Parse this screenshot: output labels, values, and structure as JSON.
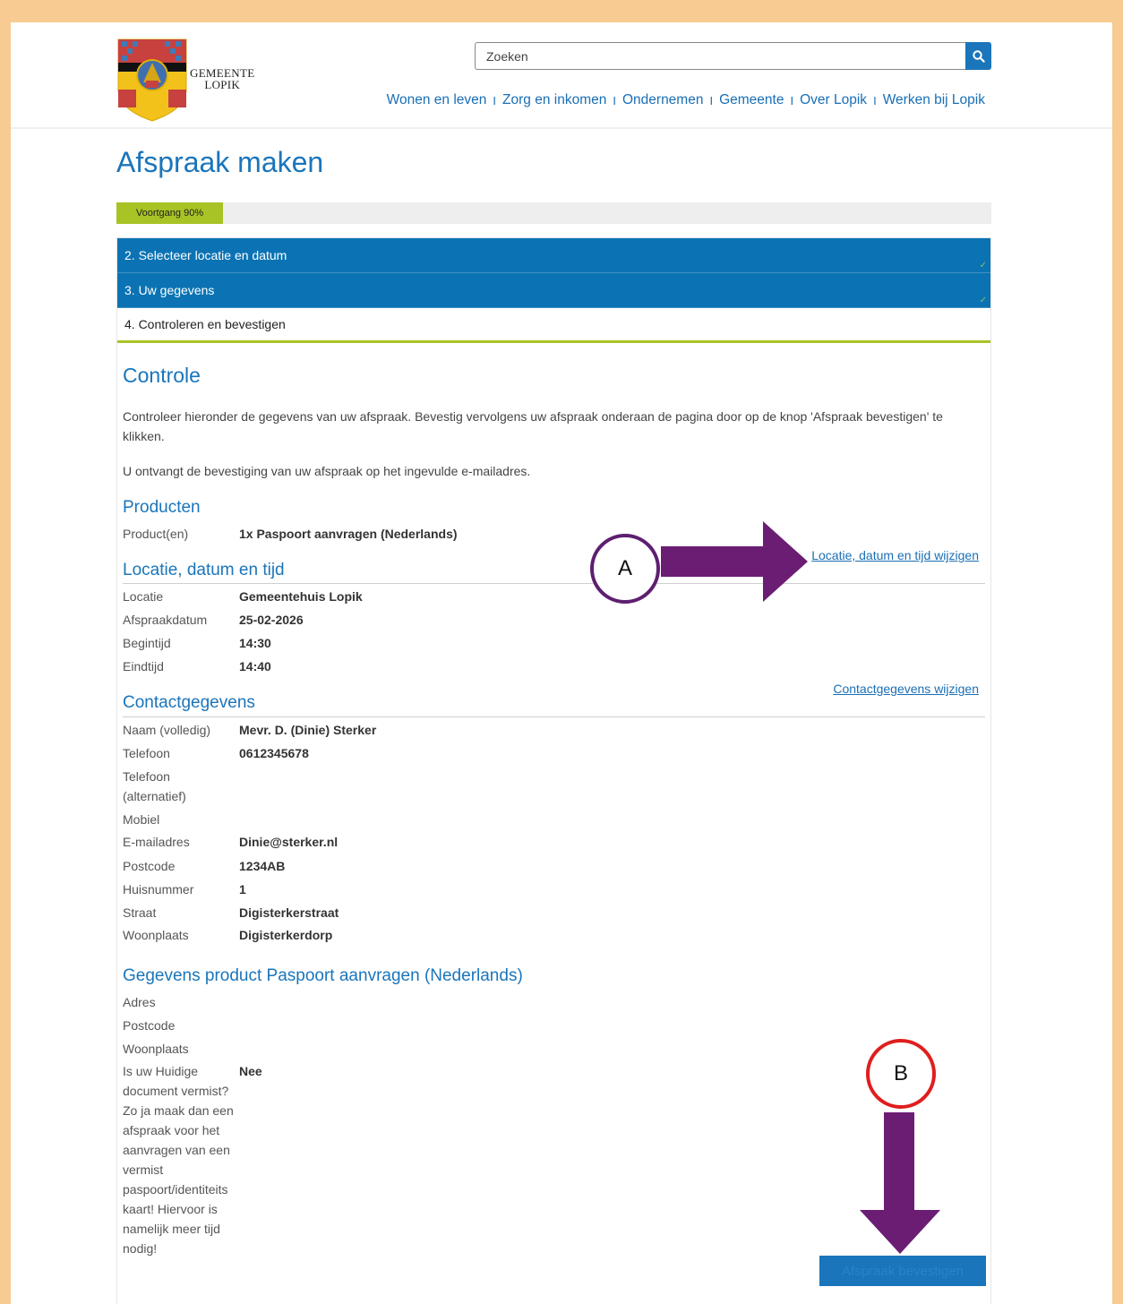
{
  "header": {
    "logo_text_line1": "GEMEENTE",
    "logo_text_line2": "LOPIK",
    "search_placeholder": "Zoeken",
    "nav": [
      "Wonen en leven",
      "Zorg en inkomen",
      "Ondernemen",
      "Gemeente",
      "Over Lopik",
      "Werken bij Lopik"
    ],
    "nav_separator": "I"
  },
  "page_title": "Afspraak maken",
  "progress": {
    "label": "Voortgang 90%",
    "value": 0.9
  },
  "steps": [
    {
      "label": "2. Selecteer locatie en datum",
      "state": "done"
    },
    {
      "label": "3. Uw gegevens",
      "state": "done"
    },
    {
      "label": "4. Controleren en bevestigen",
      "state": "current"
    }
  ],
  "controle": {
    "title": "Controle",
    "intro": "Controleer hieronder de gegevens van uw afspraak. Bevestig vervolgens uw afspraak onderaan de pagina door op de knop 'Afspraak bevestigen' te klikken.",
    "note": "U ontvangt de bevestiging van uw afspraak op het ingevulde e-mailadres."
  },
  "producten": {
    "title": "Producten",
    "label": "Product(en)",
    "value": "1x Paspoort aanvragen (Nederlands)"
  },
  "locatie": {
    "title": "Locatie, datum en tijd",
    "edit_link": "Locatie, datum en tijd wijzigen",
    "rows": [
      {
        "label": "Locatie",
        "value": "Gemeentehuis Lopik"
      },
      {
        "label": "Afspraakdatum",
        "value": "25-02-2026"
      },
      {
        "label": "Begintijd",
        "value": "14:30"
      },
      {
        "label": "Eindtijd",
        "value": "14:40"
      }
    ]
  },
  "contact": {
    "title": "Contactgegevens",
    "edit_link": "Contactgegevens wijzigen",
    "rows": [
      {
        "label": "Naam (volledig)",
        "value": "Mevr. D. (Dinie) Sterker"
      },
      {
        "label": "Telefoon",
        "value": "0612345678"
      },
      {
        "label": "Telefoon (alternatief)",
        "value": ""
      },
      {
        "label": "Mobiel",
        "value": ""
      },
      {
        "label": "E-mailadres",
        "value": "Dinie@sterker.nl"
      },
      {
        "label": "Postcode",
        "value": "1234AB"
      },
      {
        "label": "Huisnummer",
        "value": "1"
      },
      {
        "label": "Straat",
        "value": "Digisterkerstraat"
      },
      {
        "label": "Woonplaats",
        "value": "Digisterkerdorp"
      }
    ]
  },
  "product_details": {
    "title": "Gegevens product Paspoort aanvragen (Nederlands)",
    "rows": [
      {
        "label": "Adres",
        "value": ""
      },
      {
        "label": "Postcode",
        "value": ""
      },
      {
        "label": "Woonplaats",
        "value": ""
      },
      {
        "label": "Is uw Huidige document vermist? Zo ja maak dan een afspraak voor het aanvragen van een vermist paspoort/identiteits kaart! Hiervoor is namelijk meer tijd nodig!",
        "value": "Nee"
      }
    ]
  },
  "confirm_button": "Afspraak bevestigen",
  "annotations": {
    "a": "A",
    "b": "B",
    "arrow_color": "#6b1d74",
    "badge_a_color": "#5e1f6f",
    "badge_b_color": "#e01e1e"
  },
  "colors": {
    "accent": "#1a75bb",
    "progress": "#a8c325",
    "frame": "#f7cb91"
  }
}
